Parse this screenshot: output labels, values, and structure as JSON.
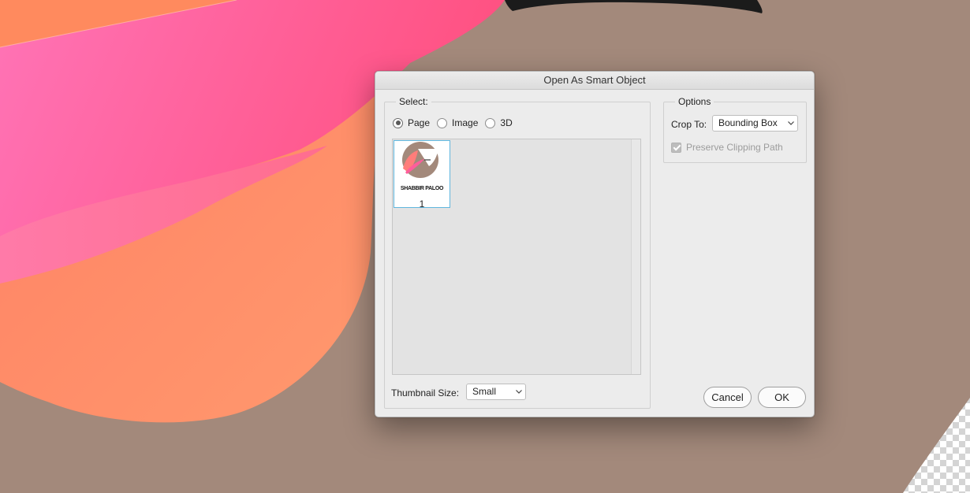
{
  "dialog": {
    "title": "Open As Smart Object",
    "select_group": {
      "label": "Select:",
      "options": [
        "Page",
        "Image",
        "3D"
      ],
      "selected": "Page"
    },
    "thumbnail": {
      "page_number": "1",
      "caption": "SHABBIR PALOO"
    },
    "thumbnail_size": {
      "label": "Thumbnail Size:",
      "value": "Small"
    },
    "options_group": {
      "label": "Options",
      "crop_to_label": "Crop To:",
      "crop_to_value": "Bounding Box",
      "preserve_clipping_label": "Preserve Clipping Path",
      "preserve_clipping_checked": true,
      "preserve_clipping_enabled": false
    },
    "buttons": {
      "cancel": "Cancel",
      "ok": "OK"
    }
  },
  "colors": {
    "canvas_background": "#a3897b",
    "shape_pink": "#ff5d9c",
    "shape_orange": "#ff8a6c",
    "selection_blue": "#5fb6de"
  }
}
